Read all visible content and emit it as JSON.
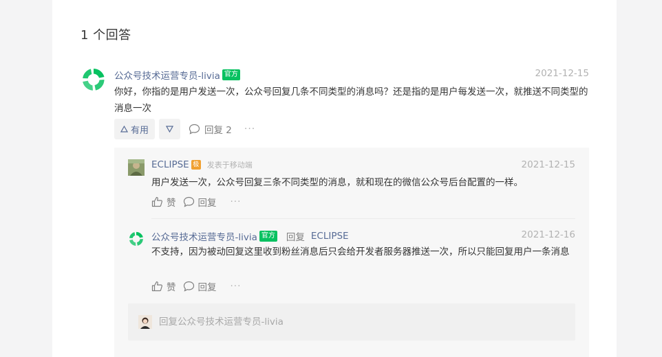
{
  "answers_count_title": "1 个回答",
  "answer": {
    "author": "公众号技术运营专员-livia",
    "badge": "官方",
    "date": "2021-12-15",
    "content": "你好，你指的是用户发送一次，公众号回复几条不同类型的消息吗？还是指的是用户每发送一次，就推送不同类型的消息一次",
    "upvote_label": "有用",
    "upvote_icon": "triangle-up-icon",
    "downvote_icon": "triangle-down-icon",
    "reply_label": "回复 2",
    "more_label": "···"
  },
  "replies": [
    {
      "author": "ECLIPSE",
      "level_badge": "极",
      "meta": "发表于移动端",
      "date": "2021-12-15",
      "content": "用户发送一次，公众号回复三条不同类型的消息，就和现在的微信公众号后台配置的一样。",
      "like_label": "赞",
      "reply_label": "回复",
      "more_label": "···"
    },
    {
      "author": "公众号技术运营专员-livia",
      "badge": "官方",
      "reply_word": "回复",
      "reply_to": "ECLIPSE",
      "date": "2021-12-16",
      "content": "不支持，因为被动回复这里收到粉丝消息后只会给开发者服务器推送一次，所以只能回复用户一条消息",
      "like_label": "赞",
      "reply_label": "回复",
      "more_label": "···"
    }
  ],
  "reply_input": {
    "placeholder": "回复公众号技术运营专员-livia",
    "value": ""
  },
  "colors": {
    "link_blue": "#576b95",
    "official_green": "#07c160",
    "level_orange": "#f0a030",
    "muted": "#b2b2b2"
  }
}
